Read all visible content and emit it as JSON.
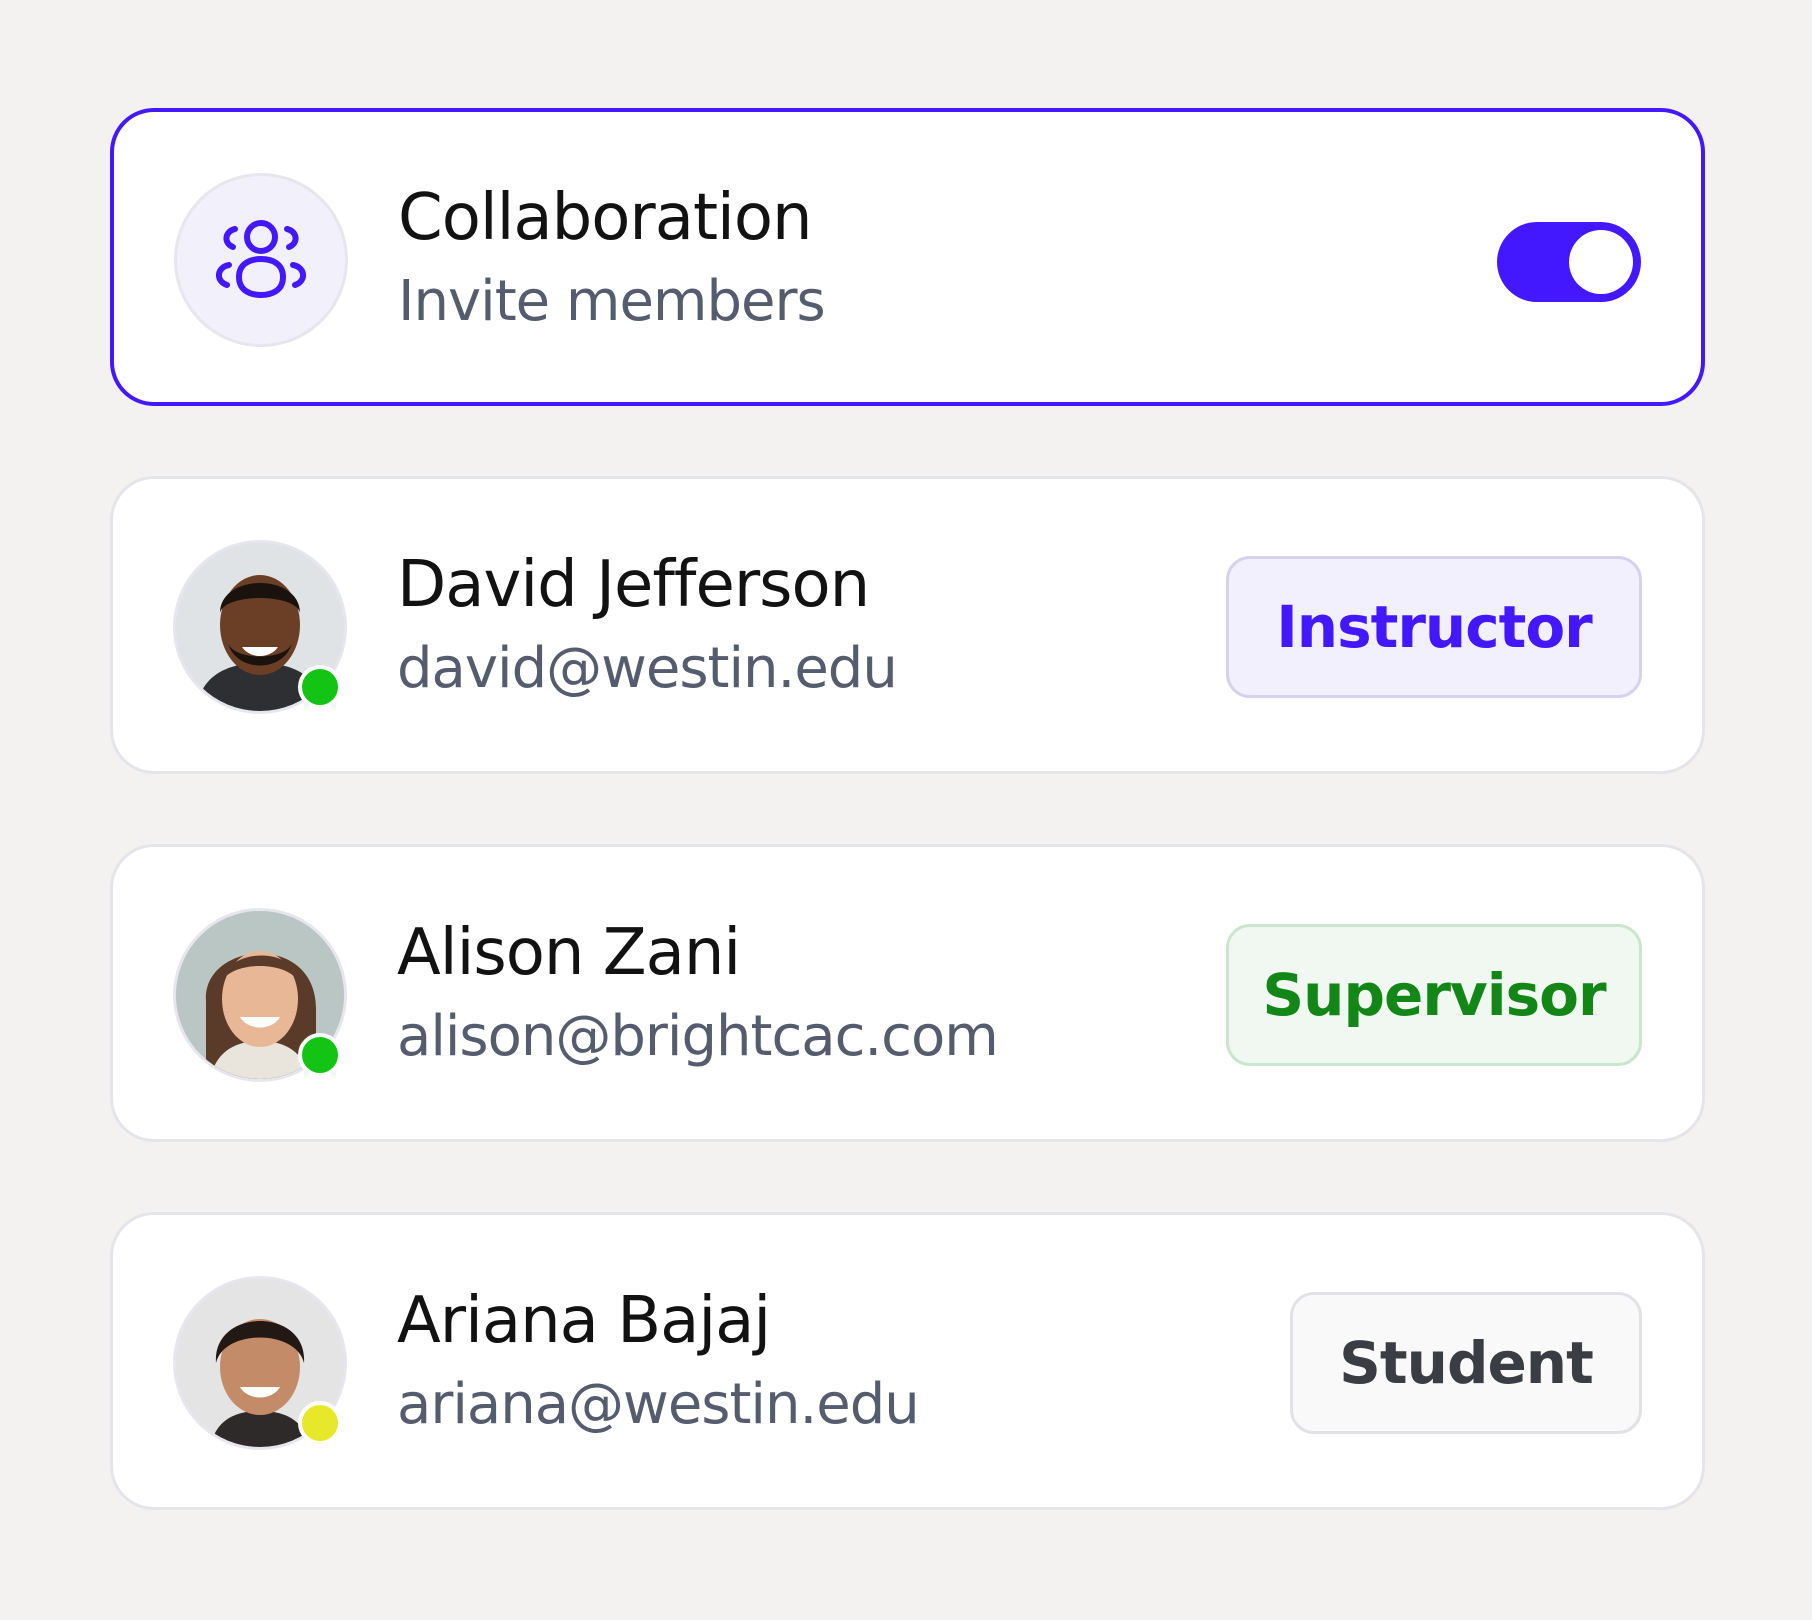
{
  "collaboration": {
    "title": "Collaboration",
    "subtitle": "Invite members",
    "icon": "users-icon",
    "toggle_on": true,
    "accent_color": "#4318ff"
  },
  "members": [
    {
      "name": "David Jefferson",
      "email": "david@westin.edu",
      "role": "Instructor",
      "status_color": "#14c414"
    },
    {
      "name": "Alison Zani",
      "email": "alison@brightcac.com",
      "role": "Supervisor",
      "status_color": "#14c414"
    },
    {
      "name": "Ariana Bajaj",
      "email": "ariana@westin.edu",
      "role": "Student",
      "status_color": "#e8e82a"
    }
  ]
}
